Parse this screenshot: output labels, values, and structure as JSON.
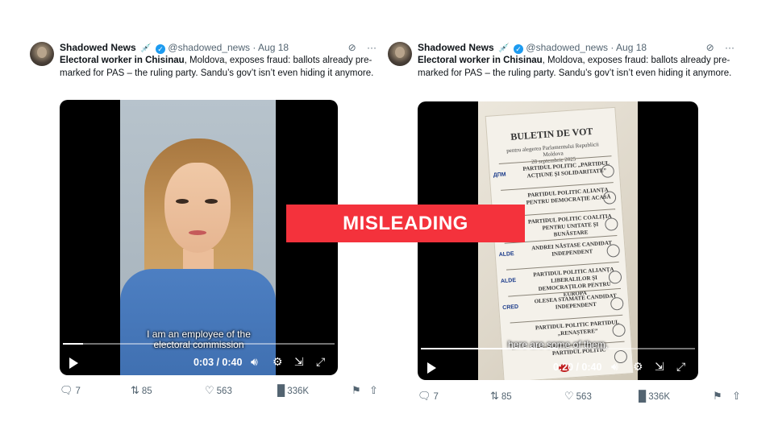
{
  "banner": {
    "label": "MISLEADING",
    "color": "#f4323c"
  },
  "tweets": [
    {
      "author": "Shadowed News",
      "handle": "@shadowed_news",
      "separator": "·",
      "date": "Aug 18",
      "text_bold": "Electoral worker in Chisinau",
      "text_rest": ", Moldova, exposes fraud: ballots already pre-marked for PAS – the ruling party. Sandu’s gov’t isn’t even hiding it anymore.",
      "caption_line1": "I am an employee of the",
      "caption_line2": "electoral commission",
      "time": "0:03 / 0:40",
      "progress": 0.075,
      "replies": "7",
      "reposts": "85",
      "likes": "563",
      "views": "336K"
    },
    {
      "author": "Shadowed News",
      "handle": "@shadowed_news",
      "separator": "·",
      "date": "Aug 18",
      "text_bold": "Electoral worker in Chisinau",
      "text_rest": ", Moldova, exposes fraud: ballots already pre-marked for PAS – the ruling party. Sandu’s gov’t isn’t even hiding it anymore.",
      "caption_line1": "here are some of them.",
      "caption_line2": "",
      "time": "0:20 / 0:40",
      "progress": 0.5,
      "replies": "7",
      "reposts": "85",
      "likes": "563",
      "views": "336K",
      "ballot": {
        "title": "BULETIN DE VOT",
        "subtitle": "pentru alegerea Parlamentului Republicii Moldova",
        "date": "28 septembrie 2025",
        "entries": [
          {
            "logo": "ДПМ",
            "name": "PARTIDUL POLITIC „PARTIDUL ACȚIUNE ȘI SOLIDARITATE”"
          },
          {
            "logo": "",
            "name": "PARTIDUL POLITIC ALIANȚA PENTRU DEMOCRAȚIE ACASĂ"
          },
          {
            "logo": "",
            "name": "PARTIDUL POLITIC COALIȚIA PENTRU UNITATE ȘI BUNĂSTARE"
          },
          {
            "logo": "ALDE",
            "name": "ANDREI NĂSTASE CANDIDAT INDEPENDENT"
          },
          {
            "logo": "ALDE",
            "name": "PARTIDUL POLITIC ALIANȚA LIBERALILOR ȘI DEMOCRAȚILOR PENTRU EUROPA"
          },
          {
            "logo": "CRED",
            "name": "OLESEA STAMATE CANDIDAT INDEPENDENT"
          },
          {
            "logo": "",
            "name": "PARTIDUL POLITIC PARTIDUL „RENAȘTERE”"
          },
          {
            "logo": "",
            "name": "PARTIDUL POLITIC"
          }
        ]
      }
    }
  ]
}
